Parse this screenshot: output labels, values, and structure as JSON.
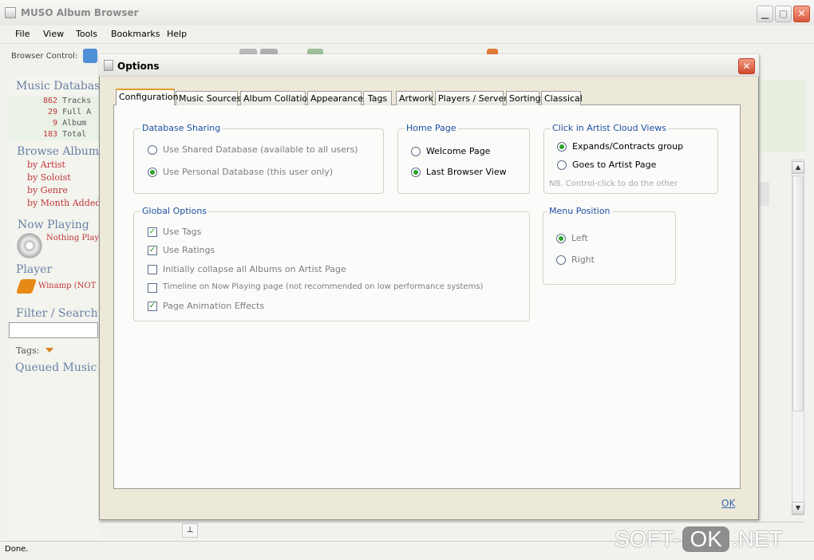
{
  "app": {
    "title": "MUSO Album Browser",
    "status": "Done.",
    "watermark_left": "SOFT-",
    "watermark_ok": "OK",
    "watermark_right": ".NET"
  },
  "menu": [
    "File",
    "View",
    "Tools",
    "Bookmarks",
    "Help"
  ],
  "toolbar": {
    "label": "Browser Control:"
  },
  "sidebar": {
    "music_database": "Music Database",
    "stats": [
      {
        "num": "862",
        "text": " Tracks"
      },
      {
        "num": " 29",
        "text": " Full A"
      },
      {
        "num": "  9",
        "text": " Album"
      },
      {
        "num": "183",
        "text": " Total"
      }
    ],
    "browse_albums": "Browse Albums",
    "browse_links": [
      "by Artist",
      "by Soloist",
      "by Genre",
      "by Month Added"
    ],
    "now_playing": "Now Playing",
    "nothing_playing": "Nothing Playi",
    "player": "Player",
    "winamp": "Winamp (NOT C",
    "filter_search": "Filter / Search",
    "tags": "Tags:",
    "queued_music": "Queued Music"
  },
  "dialog": {
    "title": "Options",
    "tabs": [
      "Configuration",
      "Music Sources",
      "Album Collation",
      "Appearance",
      "Tags",
      "Artwork",
      "Players / Server",
      "Sorting",
      "Classical"
    ],
    "database_sharing": {
      "legend": "Database Sharing",
      "opt1": "Use Shared Database (available to all users)",
      "opt2": "Use Personal Database (this user only)"
    },
    "home_page": {
      "legend": "Home Page",
      "opt1": "Welcome Page",
      "opt2": "Last Browser View"
    },
    "artist_cloud": {
      "legend": "Click in Artist Cloud Views",
      "opt1": "Expands/Contracts group",
      "opt2": "Goes to Artist Page",
      "note": "NB. Control-click to do the other"
    },
    "global_options": {
      "legend": "Global Options",
      "items": [
        {
          "label": "Use Tags",
          "checked": true
        },
        {
          "label": "Use Ratings",
          "checked": true
        },
        {
          "label": "Initially collapse all Albums on Artist Page",
          "checked": false
        },
        {
          "label": "Timeline on Now Playing page (not recommended on low performance systems)",
          "checked": false
        },
        {
          "label": "Page Animation Effects",
          "checked": true
        }
      ]
    },
    "menu_position": {
      "legend": "Menu Position",
      "opt1": "Left",
      "opt2": "Right"
    },
    "ok": "OK"
  }
}
